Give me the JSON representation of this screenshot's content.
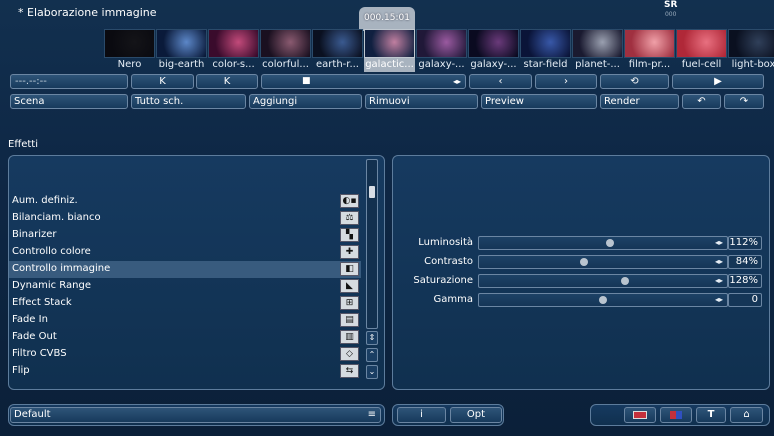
{
  "window": {
    "title": "* Elaborazione immagine",
    "brand_top": "SR",
    "brand_bottom": "000"
  },
  "timeline": {
    "current_time": "000.15:01",
    "time_field": "---.--:--",
    "clips": [
      {
        "label": "Nero",
        "c1": "#0a0a10",
        "c2": "#141418"
      },
      {
        "label": "big-earth",
        "c1": "#0a1a3a",
        "c2": "#5c87c8"
      },
      {
        "label": "color-s...",
        "c1": "#3a0b2c",
        "c2": "#c24a7a"
      },
      {
        "label": "colorful...",
        "c1": "#1a1020",
        "c2": "#8a5a70"
      },
      {
        "label": "earth-r...",
        "c1": "#0a1020",
        "c2": "#3a5a90"
      },
      {
        "label": "galactic...",
        "c1": "#102040",
        "c2": "#c07fa0"
      },
      {
        "label": "galaxy-...",
        "c1": "#201838",
        "c2": "#9a5aa0"
      },
      {
        "label": "galaxy-...",
        "c1": "#0a0a20",
        "c2": "#6a3a7a"
      },
      {
        "label": "star-field",
        "c1": "#0a1438",
        "c2": "#3858a8"
      },
      {
        "label": "planet-...",
        "c1": "#1a1a30",
        "c2": "#9aa0b0"
      },
      {
        "label": "film-pr...",
        "c1": "#a03040",
        "c2": "#f0a0a8"
      },
      {
        "label": "fuel-cell",
        "c1": "#b02838",
        "c2": "#e87080"
      },
      {
        "label": "light-box",
        "c1": "#0a1020",
        "c2": "#30405a"
      }
    ]
  },
  "transport": {
    "first": "K",
    "prev_marker": "K",
    "stop": "■",
    "mark": "◂▸",
    "prev": "‹",
    "next": "›",
    "loop": "⟲",
    "play": "▶"
  },
  "toolbar": {
    "scene": "Scena",
    "all_scenes": "Tutto sch.",
    "add": "Aggiungi",
    "remove": "Rimuovi",
    "preview": "Preview",
    "render": "Render",
    "undo": "↶",
    "redo": "↷"
  },
  "effects": {
    "label": "Effetti",
    "items": [
      {
        "label": "Aum. definiz.",
        "icon": "sharpen-icon"
      },
      {
        "label": "Bilanciam. bianco",
        "icon": "white-balance-icon"
      },
      {
        "label": "Binarizer",
        "icon": "binarizer-icon"
      },
      {
        "label": "Controllo colore",
        "icon": "color-control-icon"
      },
      {
        "label": "Controllo immagine",
        "icon": "image-control-icon",
        "selected": true
      },
      {
        "label": "Dynamic Range",
        "icon": "dynamic-range-icon"
      },
      {
        "label": "Effect Stack",
        "icon": "effect-stack-icon"
      },
      {
        "label": "Fade In",
        "icon": "fade-in-icon"
      },
      {
        "label": "Fade Out",
        "icon": "fade-out-icon"
      },
      {
        "label": "Filtro CVBS",
        "icon": "cvbs-icon"
      },
      {
        "label": "Flip",
        "icon": "flip-icon"
      }
    ]
  },
  "controls": [
    {
      "label": "Luminosità",
      "value": "112%",
      "level": 0.53
    },
    {
      "label": "Contrasto",
      "value": "84%",
      "level": 0.42
    },
    {
      "label": "Saturazione",
      "value": "128%",
      "level": 0.59
    },
    {
      "label": "Gamma",
      "value": "0",
      "level": 0.5
    }
  ],
  "bottom": {
    "preset": "Default",
    "info": "i",
    "opt": "Opt",
    "text_tool": "T",
    "home": "⌂"
  }
}
